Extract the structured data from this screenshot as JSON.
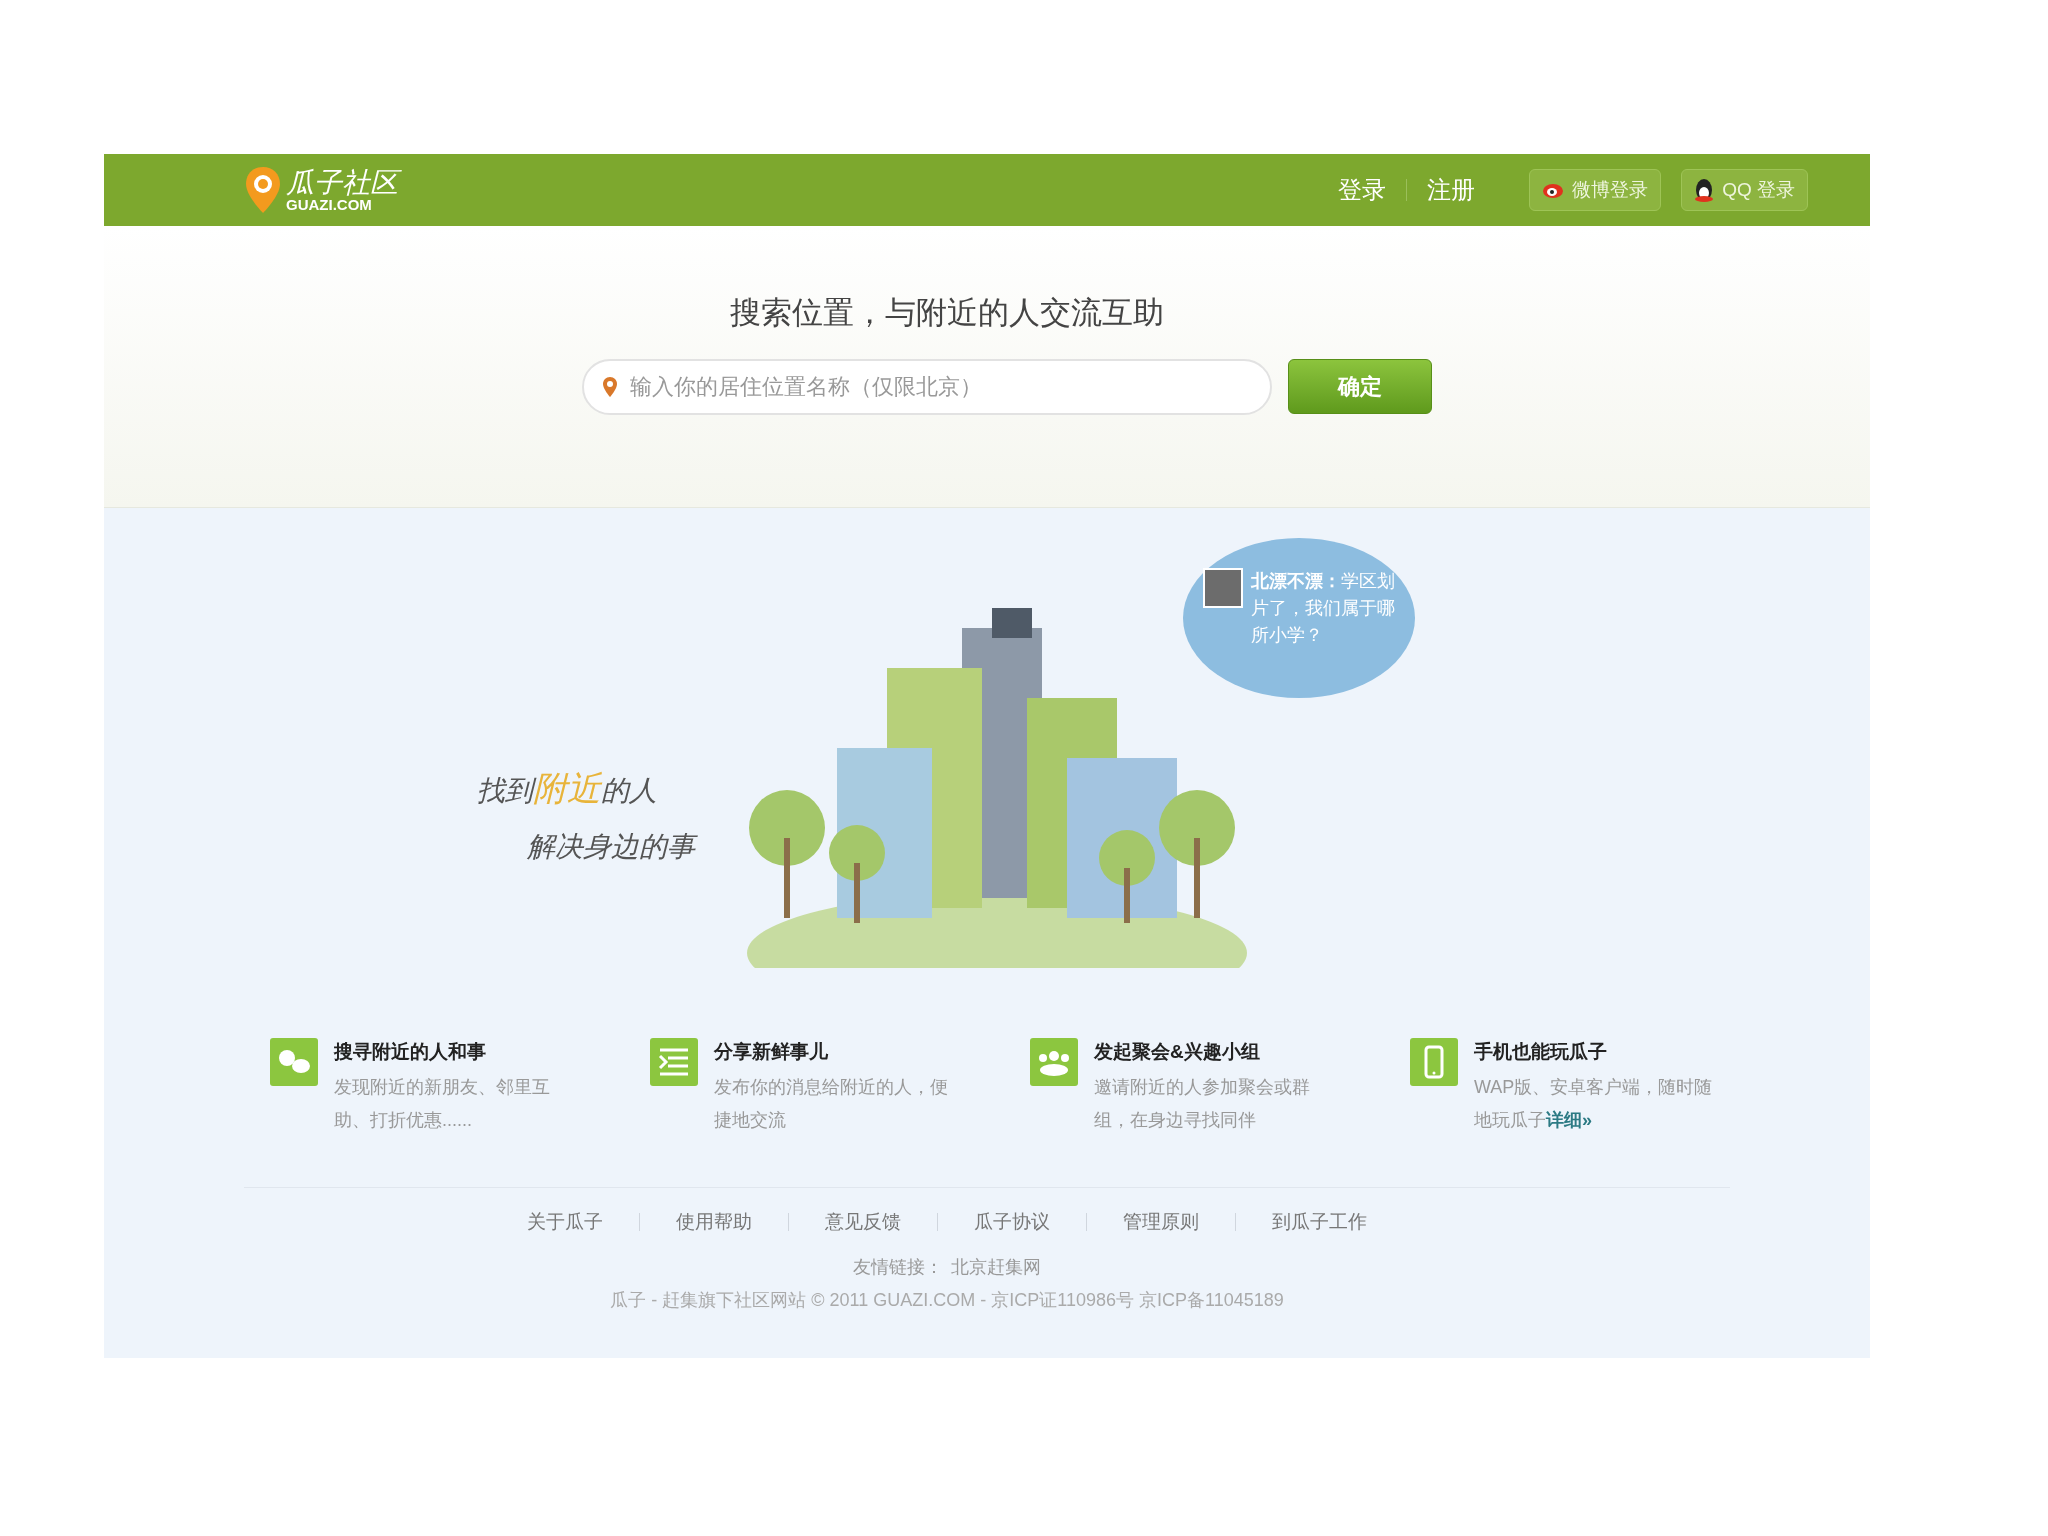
{
  "header": {
    "logo_text": "瓜子社区",
    "logo_domain": "GUAZI.COM",
    "nav_links": [
      "登录",
      "注册"
    ],
    "social_buttons": [
      {
        "kind": "weibo",
        "label": "微博登录"
      },
      {
        "kind": "qq",
        "label": "QQ 登录"
      }
    ]
  },
  "hero": {
    "headline": "搜索位置，与附近的人交流互助",
    "search": {
      "placeholder": "输入你的居住位置名称（仅限北京）"
    },
    "submit_button": "确定"
  },
  "illustration": {
    "slogan_lines": [
      [
        {
          "text": "找到",
          "highlight": false
        },
        {
          "text": "附近",
          "highlight": true
        },
        {
          "text": "的人",
          "highlight": false
        }
      ],
      [
        {
          "text": "解决身边的事",
          "highlight": false
        }
      ]
    ],
    "speech_bubble": "**北漂不漂：**学区划片了，我们属于哪所小学？"
  },
  "features": [
    {
      "kind": "people",
      "title": "搜寻附近的人和事",
      "description": "发现附近的新朋友、邻里互助、打折优惠......"
    },
    {
      "kind": "post",
      "title": "分享新鲜事儿",
      "description": "发布你的消息给附近的人，便捷地交流"
    },
    {
      "kind": "group",
      "title": "发起聚会&兴趣小组",
      "description": "邀请附近的人参加聚会或群组，在身边寻找同伴"
    },
    {
      "kind": "phone",
      "title": "手机也能玩瓜子",
      "description": "WAP版、安卓客户端，随时随地玩瓜子",
      "link": "详细»"
    }
  ],
  "footer": {
    "links": [
      "关于瓜子",
      "使用帮助",
      "意见反馈",
      "瓜子协议",
      "管理原则",
      "到瓜子工作"
    ],
    "friend_links_label": "友情链接：",
    "friend_links": [
      "北京赶集网"
    ],
    "copyright": "瓜子 - 赶集旗下社区网站 © 2011 GUAZI.COM - 京ICP证110986号 京ICP备11045189"
  }
}
